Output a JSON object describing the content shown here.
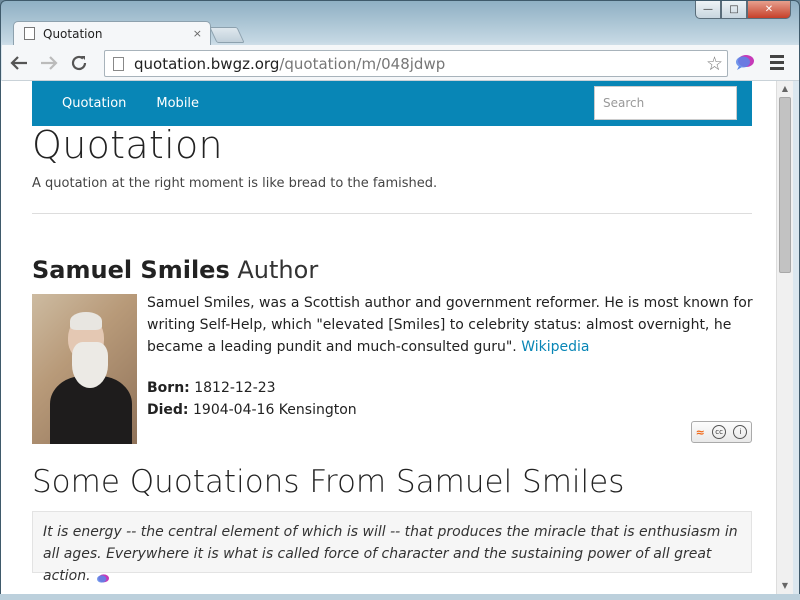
{
  "browser": {
    "tab_title": "Quotation",
    "tab_close": "×",
    "url_host": "quotation.bwgz.org",
    "url_path": "/quotation/m/048jdwp",
    "win_minimize": "—",
    "win_maximize": "□",
    "win_close": "✕"
  },
  "site": {
    "nav": [
      "Quotation",
      "Mobile"
    ],
    "search_placeholder": "Search",
    "title": "Quotation",
    "tagline": "A quotation at the right moment is like bread to the famished."
  },
  "author": {
    "name": "Samuel Smiles",
    "role": "Author",
    "bio": "Samuel Smiles, was a Scottish author and government reformer. He is most known for writing Self-Help, which \"elevated [Smiles] to celebrity status: almost overnight, he became a leading pundit and much-consulted guru\".",
    "bio_link": "Wikipedia",
    "born_label": "Born:",
    "born": "1812-12-23",
    "died_label": "Died:",
    "died": "1904-04-16 Kensington"
  },
  "quotes_section": {
    "heading": "Some Quotations From Samuel Smiles",
    "quotes": [
      "It is energy -- the central element of which is will -- that produces the miracle that is enthusiasm in all ages. Everywhere it is what is called force of character and the sustaining power of all great action."
    ]
  },
  "badge": {
    "cc_text": "cc"
  },
  "colors": {
    "nav_bg": "#0886b6",
    "link": "#0886b6"
  }
}
